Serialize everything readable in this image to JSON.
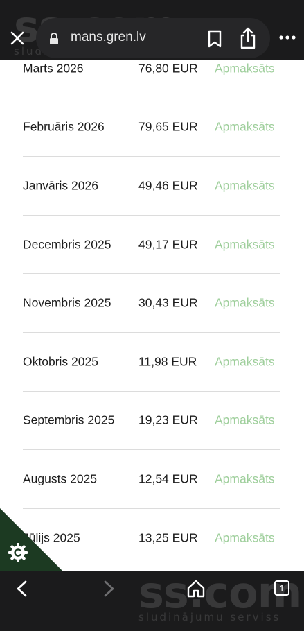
{
  "browser": {
    "url": "mans.gren.lv",
    "tab_count": "1"
  },
  "watermark": {
    "brand": "ss.com",
    "tagline": "sludinājumu serviss"
  },
  "invoices": [
    {
      "month": "Marts 2026",
      "amount": "76,80 EUR",
      "status": "Apmaksāts"
    },
    {
      "month": "Februāris 2026",
      "amount": "79,65 EUR",
      "status": "Apmaksāts"
    },
    {
      "month": "Janvāris 2026",
      "amount": "49,46 EUR",
      "status": "Apmaksāts"
    },
    {
      "month": "Decembris 2025",
      "amount": "49,17 EUR",
      "status": "Apmaksāts"
    },
    {
      "month": "Novembris 2025",
      "amount": "30,43 EUR",
      "status": "Apmaksāts"
    },
    {
      "month": "Oktobris 2025",
      "amount": "11,98 EUR",
      "status": "Apmaksāts"
    },
    {
      "month": "Septembris 2025",
      "amount": "19,23 EUR",
      "status": "Apmaksāts"
    },
    {
      "month": "Augusts 2025",
      "amount": "12,54 EUR",
      "status": "Apmaksāts"
    },
    {
      "month": "Jūlijs 2025",
      "amount": "13,25 EUR",
      "status": "Apmaksāts"
    }
  ],
  "colors": {
    "status_paid": "#9fcf9c",
    "bar_background": "#1b1b1c",
    "cookie_badge": "#1c3a22"
  },
  "icons": {
    "close": "close-icon",
    "lock": "lock-icon",
    "bookmark": "bookmark-icon",
    "share": "share-icon",
    "more": "more-dots-icon",
    "cookie": "cookie-settings-icon",
    "back": "chevron-left-icon",
    "forward": "chevron-right-icon",
    "home": "home-icon"
  }
}
